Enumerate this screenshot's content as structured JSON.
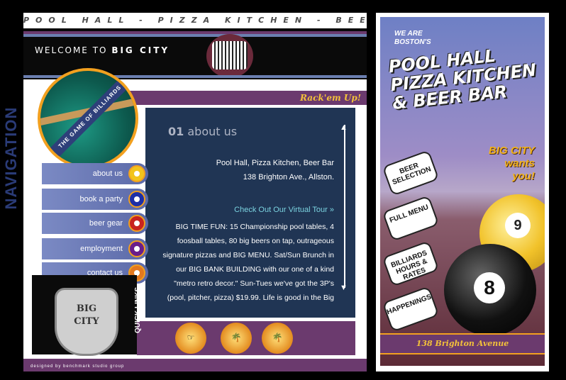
{
  "header": {
    "tagline": "POOL HALL - PIZZA KITCHEN - BEER BAR",
    "welcome_prefix": "WELCOME TO",
    "welcome_brand": "BIG CITY",
    "rack_slogan": "Rack'em Up!"
  },
  "billiard_badge": {
    "text": "THE GAME OF BILLIARDS"
  },
  "content": {
    "number": "01",
    "section_title": "about us",
    "address_line1": "Pool Hall, Pizza Kitchen, Beer Bar",
    "address_line2": "138 Brighton Ave., Allston.",
    "tour_link": "Check Out Our Virtual Tour »",
    "body": "BIG TIME FUN: 15 Championship pool tables, 4 foosball tables, 80 big beers on tap, outrageous signature pizzas and BIG MENU. Sat/Sun Brunch in our BIG BANK BUILDING with our one of a kind \"metro retro decor.\" Sun-Tues we've got the 3P's (pool, pitcher, pizza) $19.99. Life is good in the Big"
  },
  "navigation": {
    "label": "NAVIGATION",
    "items": [
      {
        "label": "about us",
        "color": "#f2c41c"
      },
      {
        "label": "book a party",
        "color": "#1e2fa6"
      },
      {
        "label": "beer gear",
        "color": "#c8231f"
      },
      {
        "label": "employment",
        "color": "#6a1e8a"
      },
      {
        "label": "contact us",
        "color": "#e3781f"
      }
    ]
  },
  "city_badge": {
    "line1": "BIG",
    "line2": "CITY"
  },
  "quick_links": {
    "label": "QUICK LINKS",
    "items": [
      {
        "icon": "pointing-hand-icon",
        "glyph": "☞"
      },
      {
        "icon": "palm-tree-icon",
        "glyph": "🌴"
      },
      {
        "icon": "palm-tree-icon",
        "glyph": "🌴"
      }
    ]
  },
  "footer": {
    "credit": "designed by benchmark studio group"
  },
  "poster": {
    "we_are": "WE ARE",
    "bostons": "BOSTON'S",
    "headline_1": "POOL HALL",
    "headline_2": "PIZZA KITCHEN",
    "headline_3": "& BEER BAR",
    "wants_1": "BIG CITY",
    "wants_2": "wants",
    "wants_3": "you!",
    "bursts": [
      {
        "label": "BEER SELECTION"
      },
      {
        "label": "FULL MENU"
      },
      {
        "label": "BILLIARDS HOURS & RATES"
      },
      {
        "label": "HAPPENINGS"
      }
    ],
    "ball_9": "9",
    "ball_8": "8",
    "address": "138 Brighton Avenue"
  }
}
